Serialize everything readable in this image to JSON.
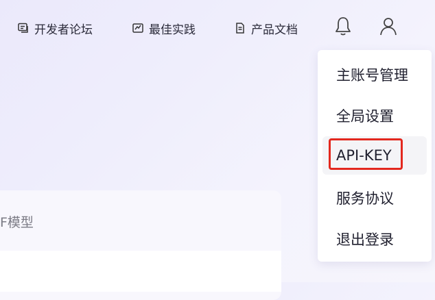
{
  "nav": {
    "links": [
      {
        "label": "开发者论坛",
        "icon": "forum-icon"
      },
      {
        "label": "最佳实践",
        "icon": "practice-icon"
      },
      {
        "label": "产品文档",
        "icon": "document-icon"
      }
    ],
    "bell_icon": "bell-icon",
    "user_icon": "user-icon"
  },
  "card": {
    "title": "F模型"
  },
  "dropdown": {
    "items": [
      {
        "label": "主账号管理"
      },
      {
        "label": "全局设置"
      },
      {
        "label": "API-KEY",
        "highlighted": true
      },
      {
        "label": "服务协议"
      },
      {
        "label": "退出登录"
      }
    ]
  },
  "colors": {
    "highlight_border": "#e3281e",
    "text": "#1f1f2e"
  }
}
